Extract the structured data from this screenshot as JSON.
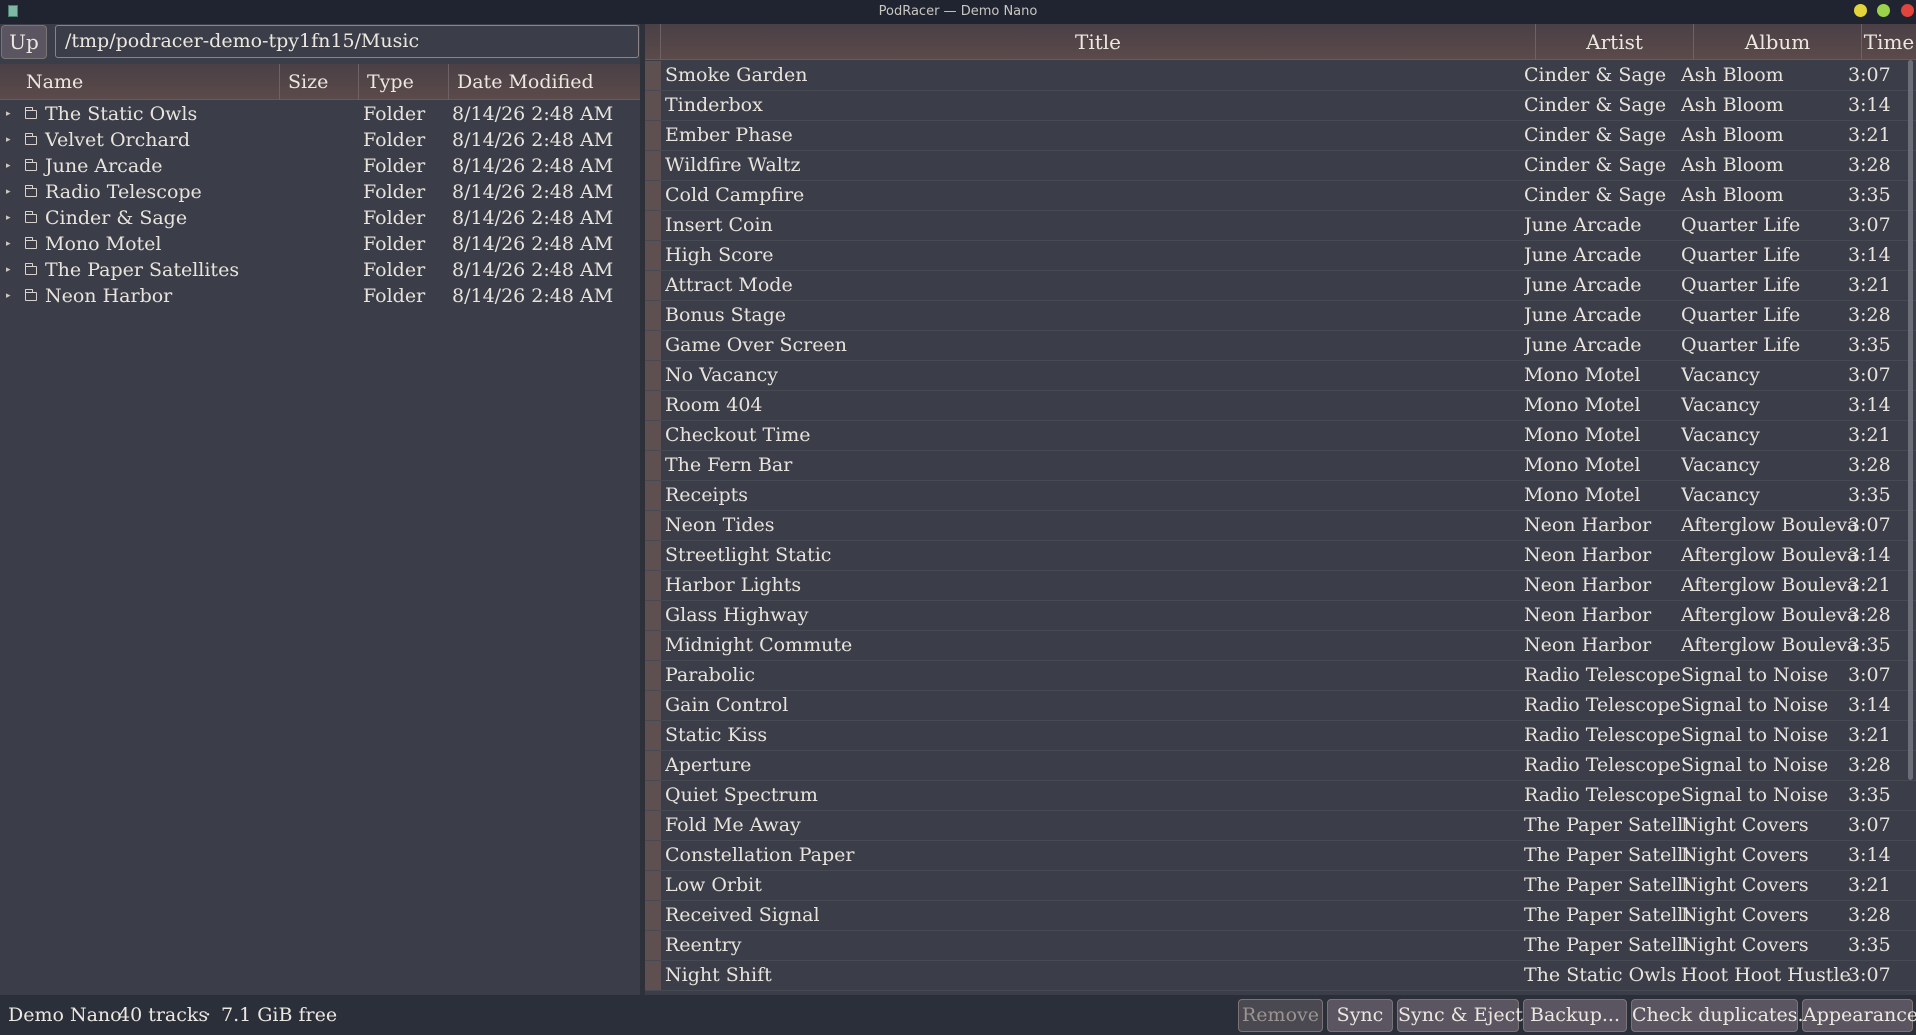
{
  "window": {
    "title": "PodRacer — Demo Nano",
    "icons": [
      "app-icon",
      "minimize-icon",
      "maximize-icon",
      "close-icon"
    ]
  },
  "browser": {
    "up_label": "Up",
    "path": "/tmp/podracer-demo-tpy1fn15/Music",
    "columns": {
      "name": "Name",
      "size": "Size",
      "type": "Type",
      "date": "Date Modified"
    },
    "items": [
      {
        "name": "The Static Owls",
        "type": "Folder",
        "date": "8/14/26 2:48 AM"
      },
      {
        "name": "Velvet Orchard",
        "type": "Folder",
        "date": "8/14/26 2:48 AM"
      },
      {
        "name": "June Arcade",
        "type": "Folder",
        "date": "8/14/26 2:48 AM"
      },
      {
        "name": "Radio Telescope",
        "type": "Folder",
        "date": "8/14/26 2:48 AM"
      },
      {
        "name": "Cinder & Sage",
        "type": "Folder",
        "date": "8/14/26 2:48 AM"
      },
      {
        "name": "Mono Motel",
        "type": "Folder",
        "date": "8/14/26 2:48 AM"
      },
      {
        "name": "The Paper Satellites",
        "type": "Folder",
        "date": "8/14/26 2:48 AM"
      },
      {
        "name": "Neon Harbor",
        "type": "Folder",
        "date": "8/14/26 2:48 AM"
      }
    ]
  },
  "tracks": {
    "columns": {
      "title": "Title",
      "artist": "Artist",
      "album": "Album",
      "time": "Time"
    },
    "rows": [
      {
        "title": "Smoke Garden",
        "artist": "Cinder & Sage",
        "album": "Ash Bloom",
        "time": "3:07"
      },
      {
        "title": "Tinderbox",
        "artist": "Cinder & Sage",
        "album": "Ash Bloom",
        "time": "3:14"
      },
      {
        "title": "Ember Phase",
        "artist": "Cinder & Sage",
        "album": "Ash Bloom",
        "time": "3:21"
      },
      {
        "title": "Wildfire Waltz",
        "artist": "Cinder & Sage",
        "album": "Ash Bloom",
        "time": "3:28"
      },
      {
        "title": "Cold Campfire",
        "artist": "Cinder & Sage",
        "album": "Ash Bloom",
        "time": "3:35"
      },
      {
        "title": "Insert Coin",
        "artist": "June Arcade",
        "album": "Quarter Life",
        "time": "3:07"
      },
      {
        "title": "High Score",
        "artist": "June Arcade",
        "album": "Quarter Life",
        "time": "3:14"
      },
      {
        "title": "Attract Mode",
        "artist": "June Arcade",
        "album": "Quarter Life",
        "time": "3:21"
      },
      {
        "title": "Bonus Stage",
        "artist": "June Arcade",
        "album": "Quarter Life",
        "time": "3:28"
      },
      {
        "title": "Game Over Screen",
        "artist": "June Arcade",
        "album": "Quarter Life",
        "time": "3:35"
      },
      {
        "title": "No Vacancy",
        "artist": "Mono Motel",
        "album": "Vacancy",
        "time": "3:07"
      },
      {
        "title": "Room 404",
        "artist": "Mono Motel",
        "album": "Vacancy",
        "time": "3:14"
      },
      {
        "title": "Checkout Time",
        "artist": "Mono Motel",
        "album": "Vacancy",
        "time": "3:21"
      },
      {
        "title": "The Fern Bar",
        "artist": "Mono Motel",
        "album": "Vacancy",
        "time": "3:28"
      },
      {
        "title": "Receipts",
        "artist": "Mono Motel",
        "album": "Vacancy",
        "time": "3:35"
      },
      {
        "title": "Neon Tides",
        "artist": "Neon Harbor",
        "album": "Afterglow Boulevard",
        "time": "3:07"
      },
      {
        "title": "Streetlight Static",
        "artist": "Neon Harbor",
        "album": "Afterglow Boulevard",
        "time": "3:14"
      },
      {
        "title": "Harbor Lights",
        "artist": "Neon Harbor",
        "album": "Afterglow Boulevard",
        "time": "3:21"
      },
      {
        "title": "Glass Highway",
        "artist": "Neon Harbor",
        "album": "Afterglow Boulevard",
        "time": "3:28"
      },
      {
        "title": "Midnight Commute",
        "artist": "Neon Harbor",
        "album": "Afterglow Boulevard",
        "time": "3:35"
      },
      {
        "title": "Parabolic",
        "artist": "Radio Telescope",
        "album": "Signal to Noise",
        "time": "3:07"
      },
      {
        "title": "Gain Control",
        "artist": "Radio Telescope",
        "album": "Signal to Noise",
        "time": "3:14"
      },
      {
        "title": "Static Kiss",
        "artist": "Radio Telescope",
        "album": "Signal to Noise",
        "time": "3:21"
      },
      {
        "title": "Aperture",
        "artist": "Radio Telescope",
        "album": "Signal to Noise",
        "time": "3:28"
      },
      {
        "title": "Quiet Spectrum",
        "artist": "Radio Telescope",
        "album": "Signal to Noise",
        "time": "3:35"
      },
      {
        "title": "Fold Me Away",
        "artist": "The Paper Satellites",
        "album": "Night Covers",
        "time": "3:07"
      },
      {
        "title": "Constellation Paper",
        "artist": "The Paper Satellites",
        "album": "Night Covers",
        "time": "3:14"
      },
      {
        "title": "Low Orbit",
        "artist": "The Paper Satellites",
        "album": "Night Covers",
        "time": "3:21"
      },
      {
        "title": "Received Signal",
        "artist": "The Paper Satellites",
        "album": "Night Covers",
        "time": "3:28"
      },
      {
        "title": "Reentry",
        "artist": "The Paper Satellites",
        "album": "Night Covers",
        "time": "3:35"
      },
      {
        "title": "Night Shift",
        "artist": "The Static Owls",
        "album": "Hoot Hoot Hustle",
        "time": "3:07"
      }
    ]
  },
  "status": {
    "device": "Demo Nano",
    "tracks": "40 tracks",
    "separator": "·",
    "free": "7.1 GiB free",
    "buttons": {
      "remove": "Remove",
      "sync": "Sync",
      "sync_eject": "Sync & Eject",
      "backup": "Backup...",
      "check_dupes": "Check duplicates...",
      "appearance": "Appearance"
    }
  }
}
